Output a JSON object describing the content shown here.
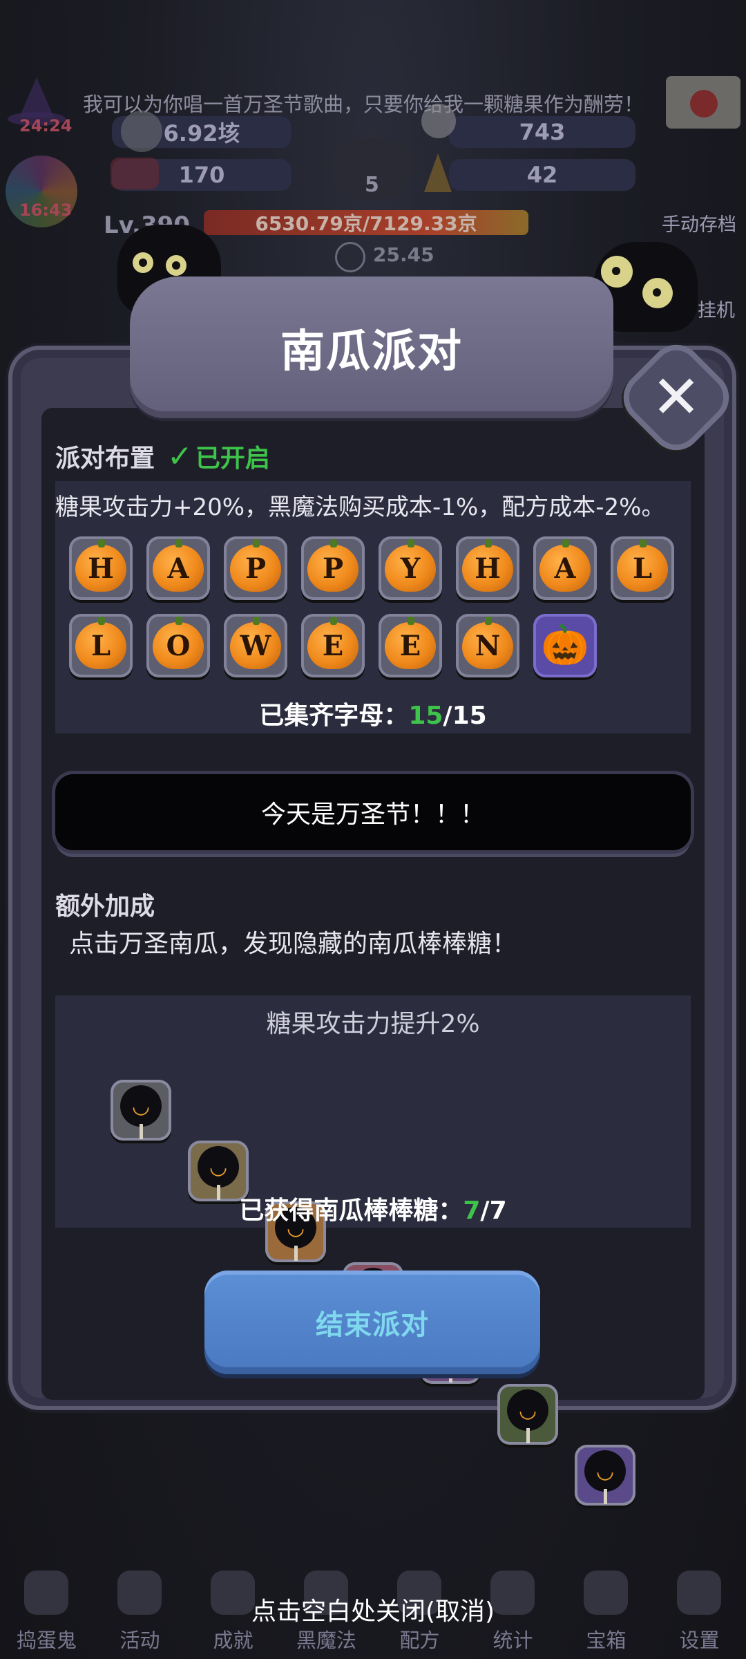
{
  "hud": {
    "marquee": "我可以为你唱一首万圣节歌曲，只要你给我一颗糖果作为酬劳！",
    "timestamp_top": "24:24",
    "timestamp_ball": "16:43",
    "stat_candy": "6.92垓",
    "stat_skull": "743",
    "stat_bow": "170",
    "stat_cauldron": "5",
    "stat_corn": "42",
    "level": "Lv.390",
    "hp": "6530.79京/7129.33京",
    "timer": "25.45",
    "manual_save": "手动存档",
    "afk": "挂机"
  },
  "dialog": {
    "title": "南瓜派对",
    "setup_label": "派对布置",
    "status_check": "✓",
    "status_text": "已开启",
    "effect_desc": "糖果攻击力+20%，黑魔法购买成本-1%，配方成本-2%。",
    "letters": [
      "H",
      "A",
      "P",
      "P",
      "Y",
      "H",
      "A",
      "L",
      "L",
      "O",
      "W",
      "E",
      "E",
      "N"
    ],
    "collected_label": "已集齐字母：",
    "collected_have": "15",
    "collected_sep": "/",
    "collected_total": "15",
    "banner": "今天是万圣节！！！",
    "extra_label": "额外加成",
    "extra_desc": "点击万圣南瓜，发现隐藏的南瓜棒棒糖！",
    "bonus_title": "糖果攻击力提升2%",
    "lolly_colors": [
      "#5c5d62",
      "#7a6b4a",
      "#9a6a3a",
      "#8a4e62",
      "#6a4a7a",
      "#4a5a3a",
      "#5a4a8a"
    ],
    "lolly_label": "已获得南瓜棒棒糖：",
    "lolly_have": "7",
    "lolly_sep": "/",
    "lolly_total": "7",
    "end_button": "结束派对"
  },
  "nav": {
    "items": [
      "捣蛋鬼",
      "活动",
      "成就",
      "黑魔法",
      "配方",
      "统计",
      "宝箱",
      "设置"
    ],
    "close_hint": "点击空白处关闭(取消)"
  },
  "colors": {
    "accent_green": "#3ec44a",
    "button_blue": "#4a79c0",
    "button_text": "#7fd8ee",
    "pumpkin_orange": "#f08a1c"
  }
}
